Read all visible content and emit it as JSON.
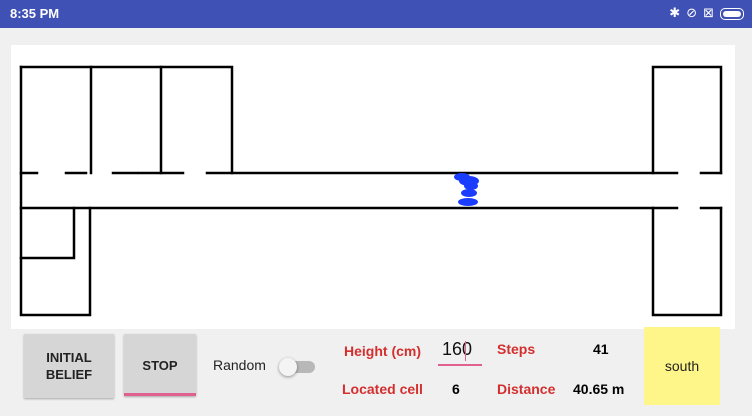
{
  "status_bar": {
    "time": "8:35 PM",
    "icons": [
      "bluetooth-icon",
      "vibrate-off-icon",
      "sim-icon",
      "battery-icon"
    ],
    "color": "#3f51b5"
  },
  "controls": {
    "initial_belief_line1": "INITIAL",
    "initial_belief_line2": "BELIEF",
    "stop_label": "STOP",
    "random_label": "Random",
    "random_on": false
  },
  "stats": {
    "height_label": "Height (cm)",
    "height_value": "160",
    "steps_label": "Steps",
    "steps_value": "41",
    "located_label": "Located cell",
    "located_value": "6",
    "distance_label": "Distance",
    "distance_value": "40.65 m",
    "direction": "south"
  },
  "colors": {
    "label_red": "#d32f2f",
    "particles_blue": "#1a3cff",
    "direction_bg": "#fff68a",
    "accent_pink": "#e06090"
  }
}
